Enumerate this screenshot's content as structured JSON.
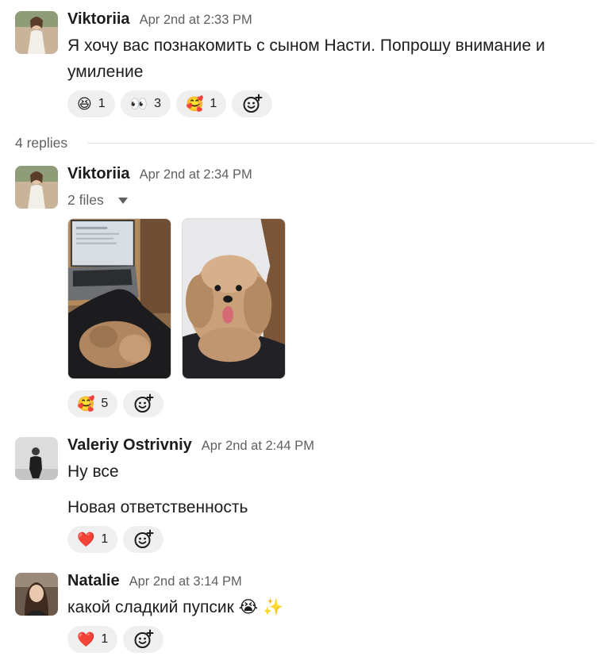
{
  "messages": [
    {
      "author": "Viktoriia",
      "time": "Apr 2nd at 2:33 PM",
      "lines": [
        "Я хочу вас познакомить с сыном Насти. Попрошу внимание и",
        "умиление"
      ],
      "reactions": [
        {
          "emoji": "😆",
          "count": "1"
        },
        {
          "emoji": "👀",
          "count": "3"
        },
        {
          "emoji": "🥰",
          "count": "1"
        }
      ]
    },
    {
      "author": "Viktoriia",
      "time": "Apr 2nd at 2:34 PM",
      "files_label": "2 files",
      "reactions": [
        {
          "emoji": "🥰",
          "count": "5"
        }
      ]
    },
    {
      "author": "Valeriy Ostrivniy",
      "time": "Apr 2nd at 2:44 PM",
      "lines": [
        "Ну все",
        "Новая ответственность"
      ],
      "reactions": [
        {
          "emoji": "❤️",
          "count": "1"
        }
      ]
    },
    {
      "author": "Natalie",
      "time": "Apr 2nd at 3:14 PM",
      "lines": [
        "какой сладкий пупсик 😭 ✨"
      ],
      "reactions": [
        {
          "emoji": "❤️",
          "count": "1"
        }
      ]
    }
  ],
  "thread": {
    "replies_label": "4 replies"
  },
  "icons": {
    "add_reaction": "add-reaction-icon",
    "files_toggle": "caret-down-icon"
  }
}
